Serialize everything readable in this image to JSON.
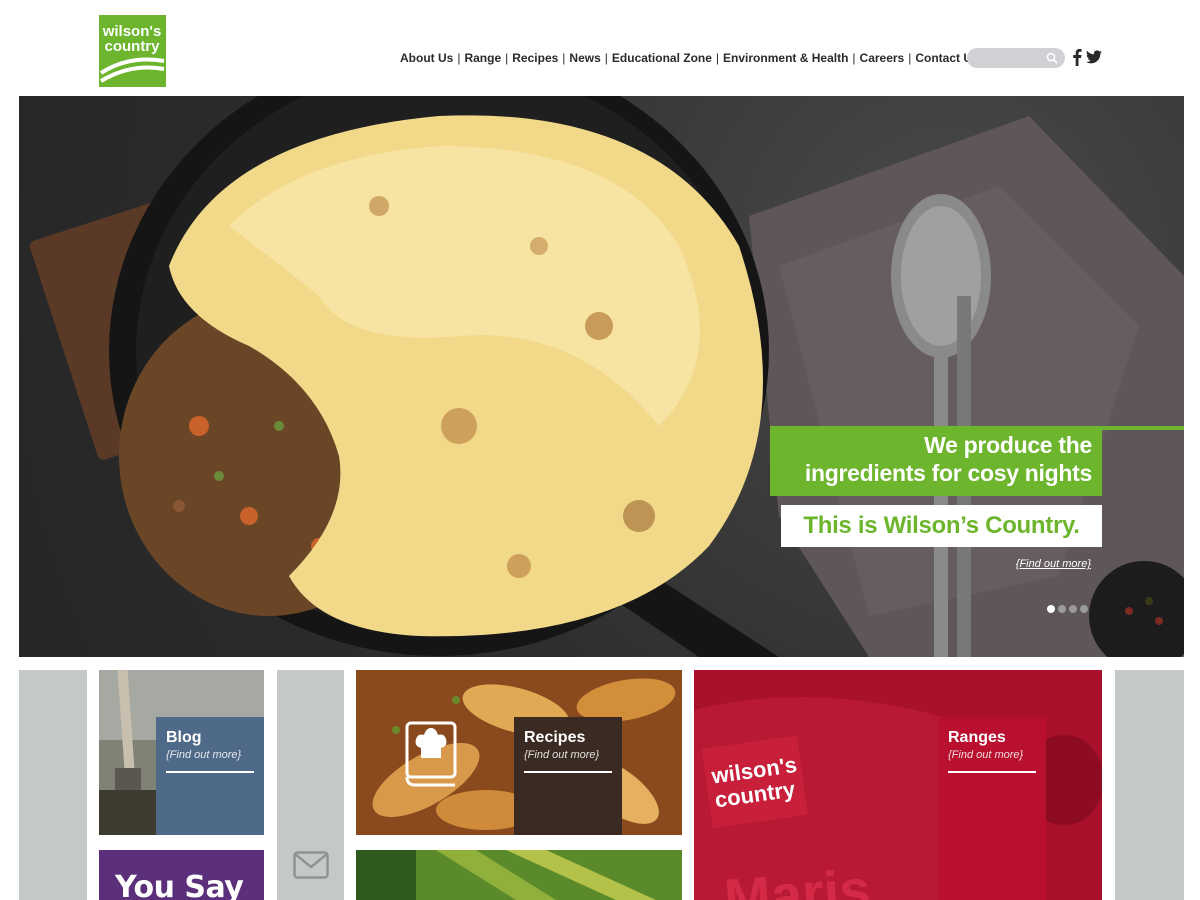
{
  "brand": {
    "logo_line1": "wilson's",
    "logo_line2": "country"
  },
  "nav": {
    "items": [
      "About Us",
      "Range",
      "Recipes",
      "News",
      "Educational Zone",
      "Environment & Health",
      "Careers",
      "Contact Us"
    ],
    "separator": "|"
  },
  "search": {
    "placeholder": "",
    "icon": "search-icon"
  },
  "social": {
    "facebook": "facebook-icon",
    "twitter": "twitter-icon"
  },
  "hero": {
    "headline_line1": "We produce the",
    "headline_line2": "ingredients for cosy nights",
    "tagline": "This is Wilson’s Country.",
    "more": "{Find out more}",
    "slide_count": 4,
    "active_slide": 1
  },
  "tiles": {
    "blog": {
      "title": "Blog",
      "more": "{Find out more}"
    },
    "recipes": {
      "title": "Recipes",
      "more": "{Find out more}"
    },
    "ranges": {
      "title": "Ranges",
      "more": "{Find out more}",
      "bag_text": "Maris",
      "bag_logo1": "wilson's",
      "bag_logo2": "country"
    },
    "you_say": {
      "title": "You Say"
    }
  },
  "colors": {
    "brand_green": "#6cb52d",
    "ranges_red": "#b8102e",
    "purple": "#5b2f7a",
    "blog_blue": "#4f6989",
    "recipes_brown": "#3b2a22",
    "side_grey": "#c4c9c7"
  }
}
